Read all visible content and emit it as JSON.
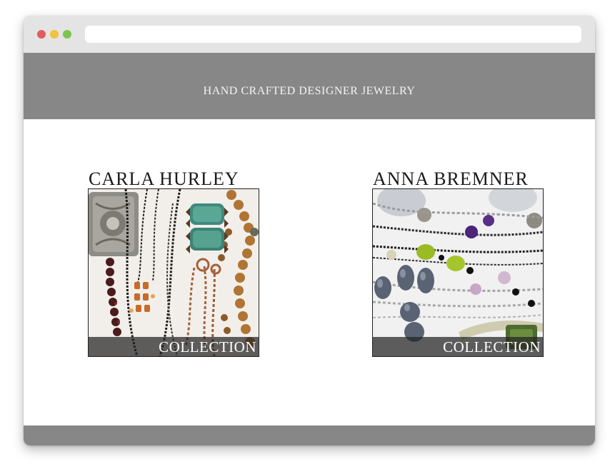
{
  "header": {
    "tagline": "HAND CRAFTED DESIGNER JEWELRY"
  },
  "collections": [
    {
      "name": "CARLA HURLEY",
      "overlay": "COLLECTION"
    },
    {
      "name": "ANNA BREMNER",
      "overlay": "COLLECTION"
    }
  ],
  "colors": {
    "header_bg": "#878787",
    "footer_bg": "#878787",
    "chrome_bg": "#e4e4e4"
  }
}
